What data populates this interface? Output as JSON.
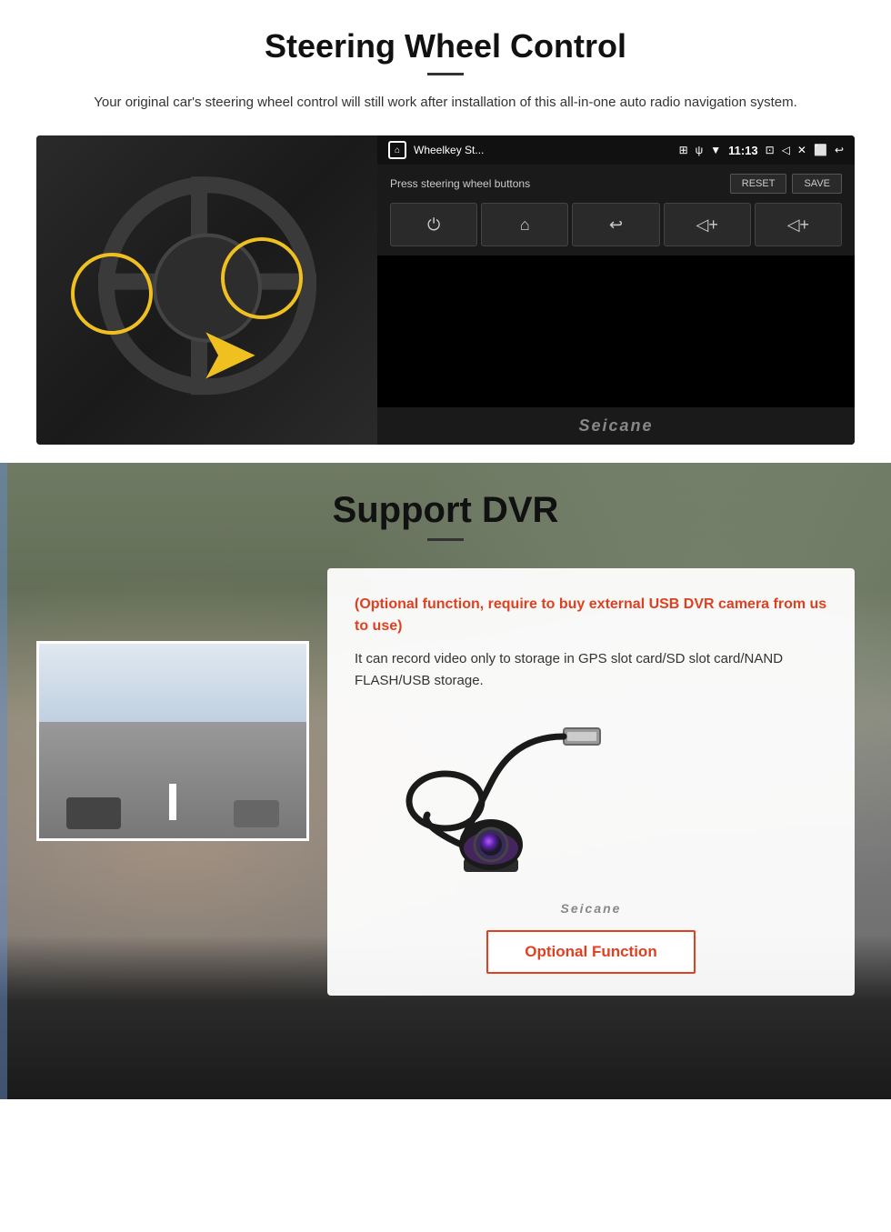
{
  "steering": {
    "title": "Steering Wheel Control",
    "subtitle": "Your original car's steering wheel control will still work after installation of this all-in-one auto radio navigation system.",
    "statusbar": {
      "title": "Wheelkey St...",
      "time": "11:13",
      "icons": [
        "▶",
        "⊞",
        "↓",
        "✕",
        "⏎",
        "↩"
      ]
    },
    "panel": {
      "instruction": "Press steering wheel buttons",
      "reset_label": "RESET",
      "save_label": "SAVE"
    },
    "controls": [
      "⏻",
      "⌂",
      "↩",
      "🔊+",
      "🔊+"
    ],
    "watermark": "Seicane"
  },
  "dvr": {
    "title": "Support DVR",
    "optional_text": "(Optional function, require to buy external USB DVR camera from us to use)",
    "description": "It can record video only to storage in GPS slot card/SD slot card/NAND FLASH/USB storage.",
    "seicane_watermark": "Seicane",
    "optional_function_label": "Optional Function"
  }
}
